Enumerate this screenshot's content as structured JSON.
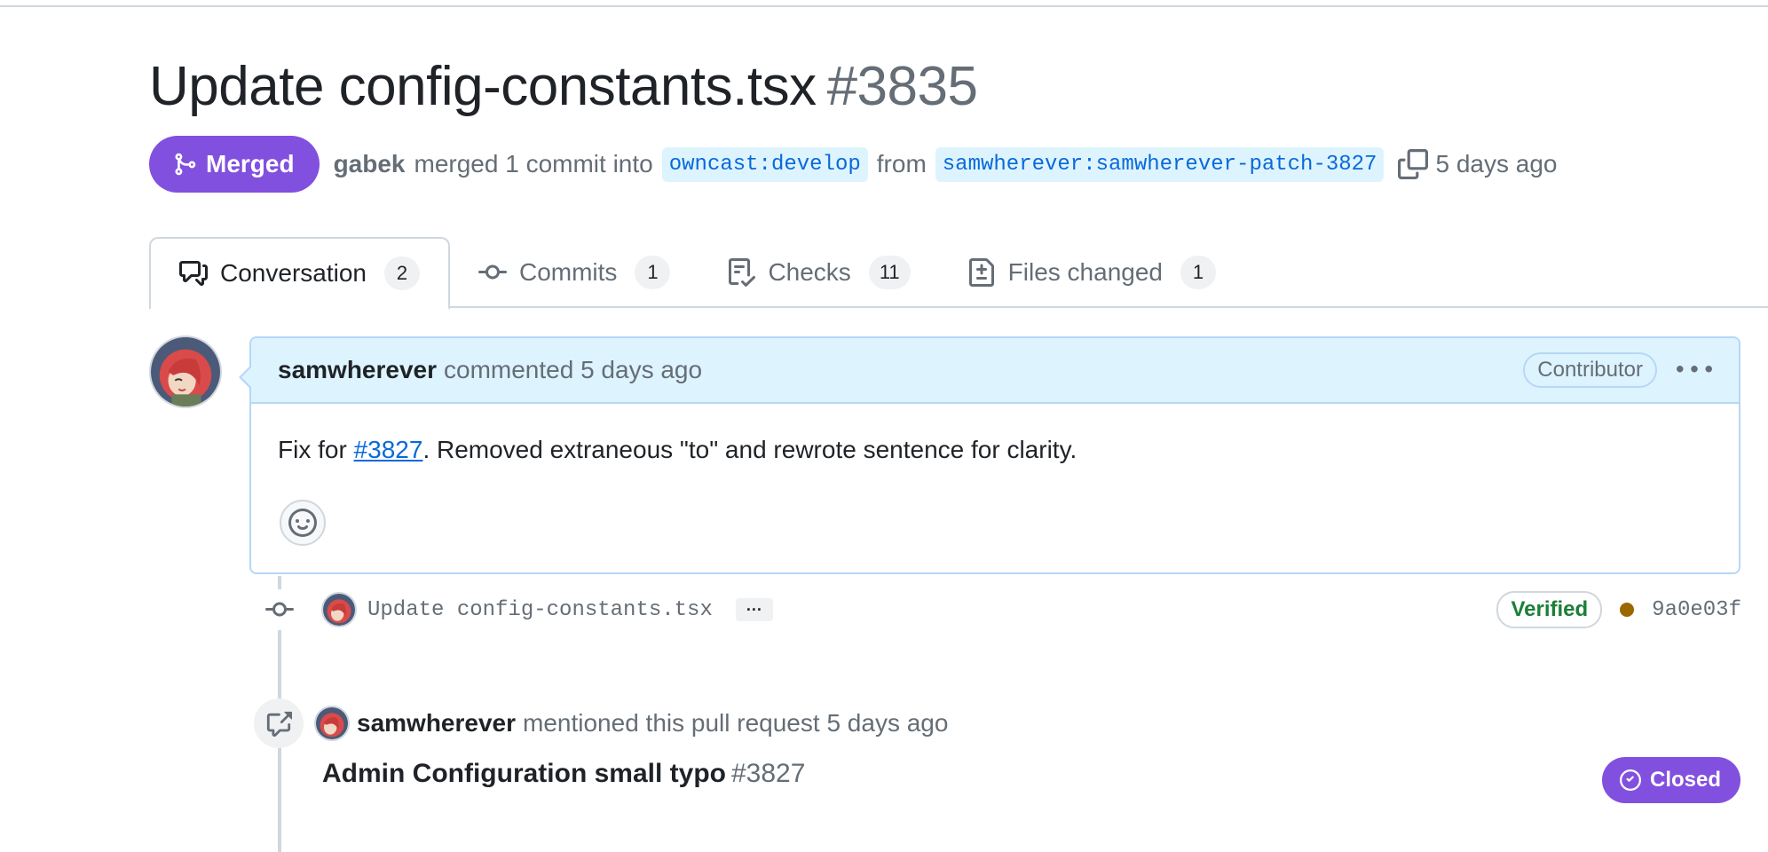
{
  "pr": {
    "title": "Update config-constants.tsx",
    "number": "#3835",
    "state": "Merged",
    "author": "gabek",
    "merge_text": "merged 1 commit into",
    "base_branch": "owncast:develop",
    "from_text": "from",
    "head_branch": "samwherever:samwherever-patch-3827",
    "time": "5 days ago"
  },
  "tabs": [
    {
      "label": "Conversation",
      "count": "2",
      "icon": "comment-discussion-icon"
    },
    {
      "label": "Commits",
      "count": "1",
      "icon": "commit-icon"
    },
    {
      "label": "Checks",
      "count": "11",
      "icon": "checklist-icon"
    },
    {
      "label": "Files changed",
      "count": "1",
      "icon": "file-diff-icon"
    }
  ],
  "comment": {
    "author": "samwherever",
    "action": "commented 5 days ago",
    "role": "Contributor",
    "body_prefix": "Fix for ",
    "body_link": "#3827",
    "body_suffix": ". Removed extraneous \"to\" and rewrote sentence for clarity."
  },
  "commit": {
    "message": "Update config-constants.tsx",
    "more": "···",
    "verified": "Verified",
    "sha": "9a0e03f"
  },
  "mention": {
    "author": "samwherever",
    "text": "mentioned this pull request 5 days ago",
    "ref_title": "Admin Configuration small typo",
    "ref_number": "#3827",
    "ref_state": "Closed"
  },
  "colors": {
    "merged": "#8250df",
    "link": "#0969da",
    "verified": "#1a7f37",
    "comment_header": "#ddf4ff"
  }
}
